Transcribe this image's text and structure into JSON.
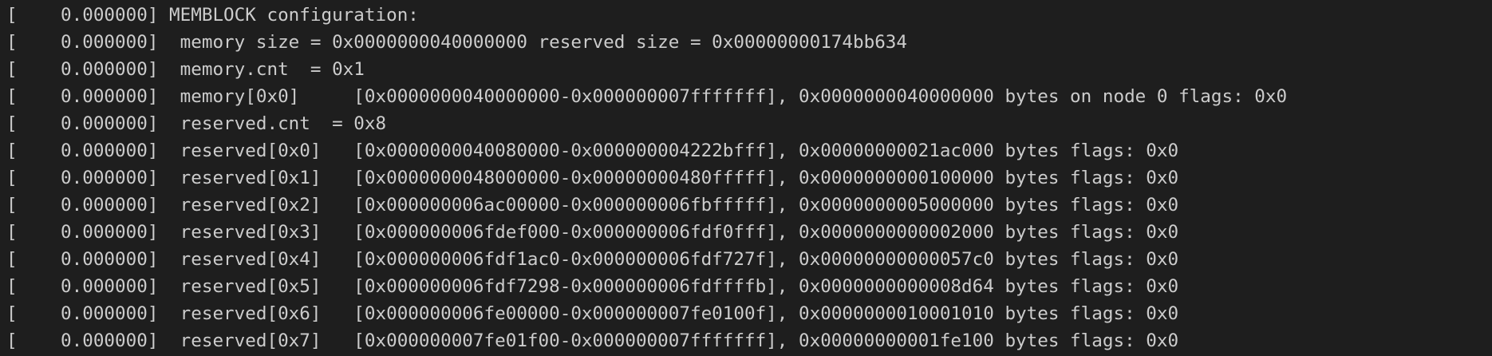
{
  "terminal": {
    "lines": [
      "[    0.000000] MEMBLOCK configuration:",
      "[    0.000000]  memory size = 0x0000000040000000 reserved size = 0x00000000174bb634",
      "[    0.000000]  memory.cnt  = 0x1",
      "[    0.000000]  memory[0x0]     [0x0000000040000000-0x000000007fffffff], 0x0000000040000000 bytes on node 0 flags: 0x0",
      "[    0.000000]  reserved.cnt  = 0x8",
      "[    0.000000]  reserved[0x0]   [0x0000000040080000-0x000000004222bfff], 0x00000000021ac000 bytes flags: 0x0",
      "[    0.000000]  reserved[0x1]   [0x0000000048000000-0x00000000480fffff], 0x0000000000100000 bytes flags: 0x0",
      "[    0.000000]  reserved[0x2]   [0x000000006ac00000-0x000000006fbfffff], 0x0000000005000000 bytes flags: 0x0",
      "[    0.000000]  reserved[0x3]   [0x000000006fdef000-0x000000006fdf0fff], 0x0000000000002000 bytes flags: 0x0",
      "[    0.000000]  reserved[0x4]   [0x000000006fdf1ac0-0x000000006fdf727f], 0x00000000000057c0 bytes flags: 0x0",
      "[    0.000000]  reserved[0x5]   [0x000000006fdf7298-0x000000006fdffffb], 0x0000000000008d64 bytes flags: 0x0",
      "[    0.000000]  reserved[0x6]   [0x000000006fe00000-0x000000007fe0100f], 0x0000000010001010 bytes flags: 0x0",
      "[    0.000000]  reserved[0x7]   [0x000000007fe01f00-0x000000007fffffff], 0x00000000001fe100 bytes flags: 0x0"
    ]
  },
  "colors": {
    "background": "#1e1e1e",
    "text": "#cccccc"
  }
}
